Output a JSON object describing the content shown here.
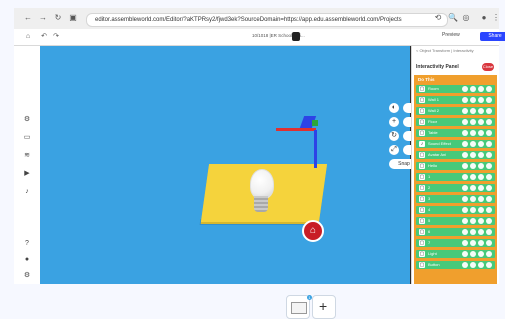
{
  "browser": {
    "url": "editor.assembleworld.com/Editor/?aKTPRsy2/fjwd3ek?SourceDomain=https://app.edu.assembleworld.com/Projects"
  },
  "toolbar": {
    "project_title": "10/1018 |ER Schools Pri...",
    "preview_label": "Preview",
    "share_label": "Share"
  },
  "viewport": {
    "tools": [
      "Tools",
      "Move",
      "Rotate",
      "Scale",
      "Snap"
    ]
  },
  "panel": {
    "breadcrumb": "< Object Transform | Interactivity",
    "header": "Interactivity Panel",
    "close_label": "Close",
    "list_title": "Do This",
    "items": [
      {
        "label": "Room"
      },
      {
        "label": "Wall 1"
      },
      {
        "label": "Wall 2"
      },
      {
        "label": "Floor"
      },
      {
        "label": "Table"
      },
      {
        "label": "Sound Effect"
      },
      {
        "label": "Avatar Ani"
      },
      {
        "label": "Hello"
      },
      {
        "label": "1"
      },
      {
        "label": "2"
      },
      {
        "label": "3"
      },
      {
        "label": "4"
      },
      {
        "label": "5"
      },
      {
        "label": "6"
      },
      {
        "label": "7"
      },
      {
        "label": "Light"
      },
      {
        "label": "Button"
      }
    ]
  }
}
